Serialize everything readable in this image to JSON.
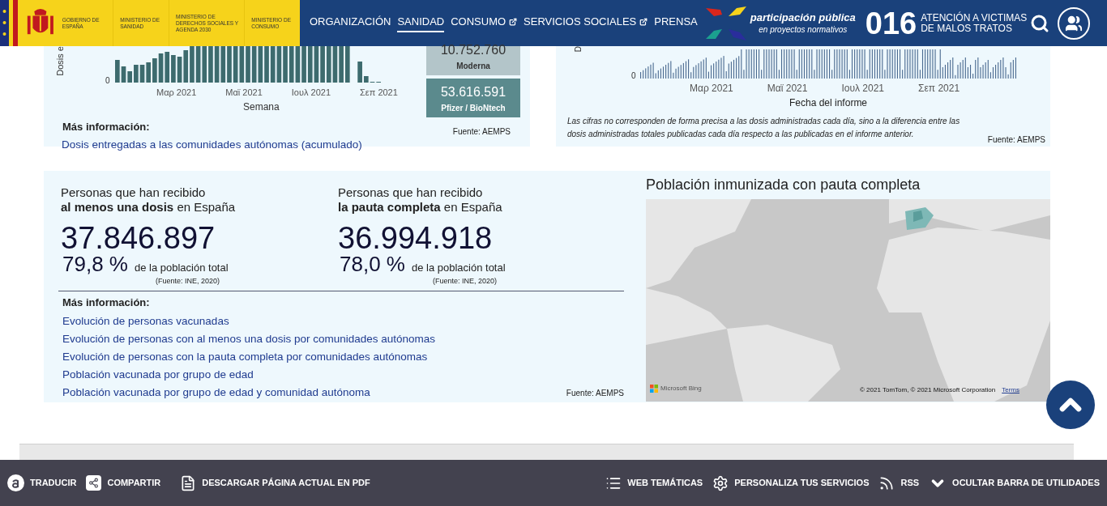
{
  "header": {
    "agencies": [
      "GOBIERNO DE ESPAÑA",
      "MINISTERIO DE SANIDAD",
      "MINISTERIO DE DERECHOS SOCIALES Y AGENDA 2030",
      "MINISTERIO DE CONSUMO"
    ],
    "nav": [
      {
        "label": "ORGANIZACIÓN",
        "selected": false,
        "external": false
      },
      {
        "label": "SANIDAD",
        "selected": true,
        "external": false
      },
      {
        "label": "CONSUMO",
        "selected": false,
        "external": true
      },
      {
        "label": "SERVICIOS SOCIALES",
        "selected": false,
        "external": true
      },
      {
        "label": "PRENSA",
        "selected": false,
        "external": false
      }
    ],
    "participation": {
      "title": "participación pública",
      "subtitle": "en proyectos normativos"
    },
    "hotline": {
      "number": "016",
      "line1": "ATENCIÓN A VICTIMAS",
      "line2": "DE MALOS TRATOS"
    }
  },
  "weekly_card": {
    "axis_title": "Dosis e",
    "y_tick": "0",
    "x_labels": [
      "Μαρ 2021",
      "Μαϊ 2021",
      "Ιουλ 2021",
      "Σεπ 2021"
    ],
    "xlabel": "Semana",
    "vaccine_boxes": [
      {
        "value": "10.752.760",
        "label": "Moderna",
        "color": "#b3c5c9"
      },
      {
        "value": "53.616.591",
        "label": "Pfizer / BioNtech",
        "color": "#5b8a8d"
      }
    ],
    "more_info_title": "Más información:",
    "links": [
      "Dosis entregadas a las comunidades autónomas (acumulado)"
    ],
    "source": "Fuente: AEMPS"
  },
  "daily_card": {
    "axis_title": "D",
    "y_tick": "0",
    "x_labels": [
      "Μαρ 2021",
      "Μαϊ 2021",
      "Ιουλ 2021",
      "Σεπ 2021"
    ],
    "xlabel": "Fecha del informe",
    "note": "Las cifras no corresponden de forma precisa a las dosis administradas cada día, sino a la diferencia entre las dosis administradas totales publicadas cada día respecto a las publicadas en el informe anterior.",
    "source": "Fuente: AEMPS"
  },
  "stats": [
    {
      "line1": "Personas que han recibido",
      "line2": "**al menos una dosis** en España",
      "count": "37.846.897",
      "percent": "79,8 %",
      "percent_label": "de la población total",
      "source": "(Fuente: INE, 2020)"
    },
    {
      "line1": "Personas que han recibido",
      "line2": "**la pauta completa** en España",
      "count": "36.994.918",
      "percent": "78,0 %",
      "percent_label": "de la población total",
      "source": "(Fuente: INE, 2020)"
    }
  ],
  "more_info": {
    "title": "Más información:",
    "links": [
      "Evolución de personas vacunadas",
      "Evolución de personas con al menos una dosis por comunidades autónomas",
      "Evolución de personas con la pauta completa por comunidades autónomas",
      "Población vacunada por grupo de edad",
      "Población vacunada por grupo de edad y comunidad autónoma"
    ],
    "source": "Fuente: AEMPS"
  },
  "map": {
    "title": "Población inmunizada con pauta completa",
    "brand": "Microsoft Bing",
    "copyright": "© 2021 TomTom, © 2021 Microsoft Corporation",
    "terms": "Terms"
  },
  "toolbar": {
    "left": [
      {
        "kind": "translate",
        "label": "TRADUCIR"
      },
      {
        "kind": "share",
        "label": "COMPARTIR"
      },
      {
        "kind": "pdf",
        "label": "DESCARGAR PÁGINA ACTUAL EN PDF"
      }
    ],
    "right": [
      {
        "kind": "list",
        "label": "WEB TEMÁTICAS"
      },
      {
        "kind": "gear",
        "label": "PERSONALIZA TUS SERVICIOS"
      },
      {
        "kind": "rss",
        "label": "RSS"
      },
      {
        "kind": "chevron",
        "label": "OCULTAR BARRA DE UTILIDADES"
      }
    ]
  }
}
